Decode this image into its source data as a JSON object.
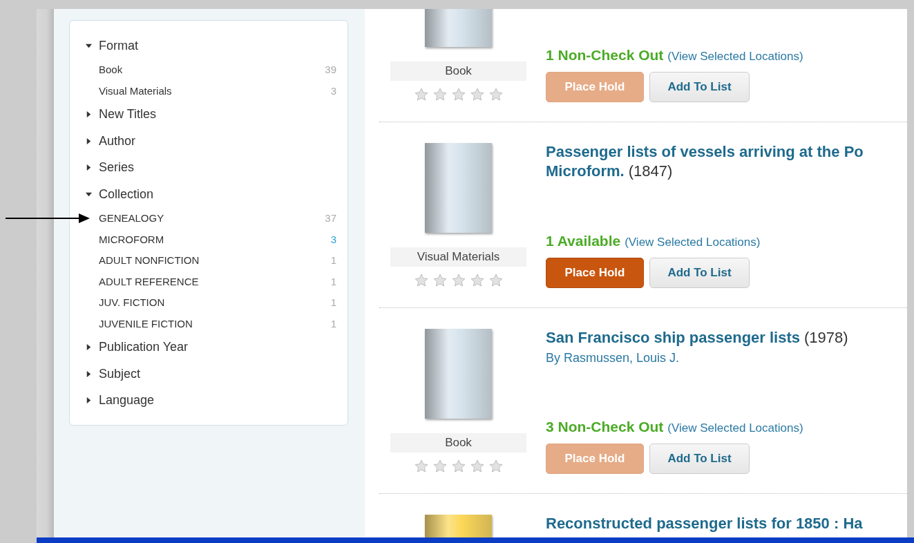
{
  "facets": [
    {
      "label": "Format",
      "expanded": true,
      "items": [
        {
          "label": "Book",
          "count": "39",
          "selected": false,
          "arrow": false
        },
        {
          "label": "Visual Materials",
          "count": "3",
          "selected": false,
          "arrow": false
        }
      ]
    },
    {
      "label": "New Titles",
      "expanded": false
    },
    {
      "label": "Author",
      "expanded": false
    },
    {
      "label": "Series",
      "expanded": false
    },
    {
      "label": "Collection",
      "expanded": true,
      "items": [
        {
          "label": "GENEALOGY",
          "count": "37",
          "selected": false,
          "arrow": true
        },
        {
          "label": "MICROFORM",
          "count": "3",
          "selected": true,
          "arrow": false
        },
        {
          "label": "ADULT NONFICTION",
          "count": "1",
          "selected": false,
          "arrow": false
        },
        {
          "label": "ADULT REFERENCE",
          "count": "1",
          "selected": false,
          "arrow": false
        },
        {
          "label": "JUV. FICTION",
          "count": "1",
          "selected": false,
          "arrow": false
        },
        {
          "label": "JUVENILE FICTION",
          "count": "1",
          "selected": false,
          "arrow": false
        }
      ]
    },
    {
      "label": "Publication Year",
      "expanded": false
    },
    {
      "label": "Subject",
      "expanded": false
    },
    {
      "label": "Language",
      "expanded": false
    }
  ],
  "results": [
    {
      "color": "#d6e3ec",
      "format": "Book",
      "stars": 0,
      "availability": "1 Non-Check Out",
      "locations_link": "(View Selected Locations)",
      "buttons": [
        {
          "label": "Place Hold",
          "kind": "hold",
          "disabled": true
        },
        {
          "label": "Add To List",
          "kind": "list",
          "disabled": false
        }
      ]
    },
    {
      "color": "#d6e3ec",
      "title_lines": [
        "Passenger lists of vessels arriving at the Po",
        "Microform."
      ],
      "year": "(1847)",
      "format": "Visual Materials",
      "stars": 0,
      "availability": "1 Available",
      "locations_link": "(View Selected Locations)",
      "buttons": [
        {
          "label": "Place Hold",
          "kind": "hold",
          "disabled": false
        },
        {
          "label": "Add To List",
          "kind": "list",
          "disabled": false
        }
      ]
    },
    {
      "color": "#d6e3ec",
      "title_lines": [
        "San Francisco ship passenger lists"
      ],
      "year": "(1978)",
      "author": "By Rasmussen, Louis J.",
      "format": "Book",
      "stars": 0,
      "availability": "3 Non-Check Out",
      "locations_link": "(View Selected Locations)",
      "buttons": [
        {
          "label": "Place Hold",
          "kind": "hold",
          "disabled": true
        },
        {
          "label": "Add To List",
          "kind": "list",
          "disabled": false
        }
      ]
    },
    {
      "color": "#fcd757",
      "title_lines": [
        "Reconstructed passenger lists for 1850 : Ha"
      ]
    }
  ]
}
